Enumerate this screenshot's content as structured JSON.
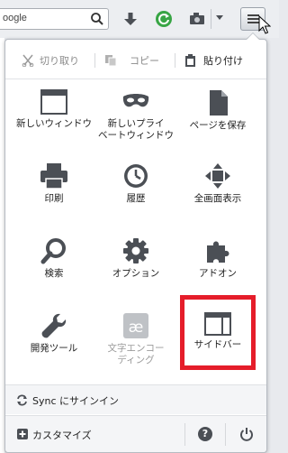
{
  "toolbar": {
    "search_text": "oogle",
    "icons": [
      "search-icon",
      "download-arrow-icon",
      "reload-extension-icon",
      "screenshot-icon",
      "dropdown-arrow-icon",
      "hamburger-menu-icon"
    ]
  },
  "menu": {
    "edit": {
      "cut_label": "切り取り",
      "copy_label": "コピー",
      "paste_label": "貼り付け"
    },
    "items": [
      {
        "label": "新しいウィンドウ",
        "icon": "new-window-icon",
        "enabled": true
      },
      {
        "label": "新しいプライ\nベートウィンドウ",
        "icon": "private-mask-icon",
        "enabled": true
      },
      {
        "label": "ページを保存",
        "icon": "save-page-icon",
        "enabled": true
      },
      {
        "label": "印刷",
        "icon": "print-icon",
        "enabled": true
      },
      {
        "label": "履歴",
        "icon": "history-clock-icon",
        "enabled": true
      },
      {
        "label": "全画面表示",
        "icon": "fullscreen-icon",
        "enabled": true
      },
      {
        "label": "検索",
        "icon": "search-icon",
        "enabled": true
      },
      {
        "label": "オプション",
        "icon": "gear-icon",
        "enabled": true
      },
      {
        "label": "アドオン",
        "icon": "puzzle-icon",
        "enabled": true
      },
      {
        "label": "開発ツール",
        "icon": "wrench-icon",
        "enabled": true
      },
      {
        "label": "文字エンコー\nディング",
        "icon": "encoding-icon",
        "enabled": false
      },
      {
        "label": "サイドバー",
        "icon": "sidebar-icon",
        "enabled": true
      }
    ],
    "highlight_color": "#e51d2a",
    "sync_label": "Sync にサインイン",
    "customize_label": "カスタマイズ"
  }
}
